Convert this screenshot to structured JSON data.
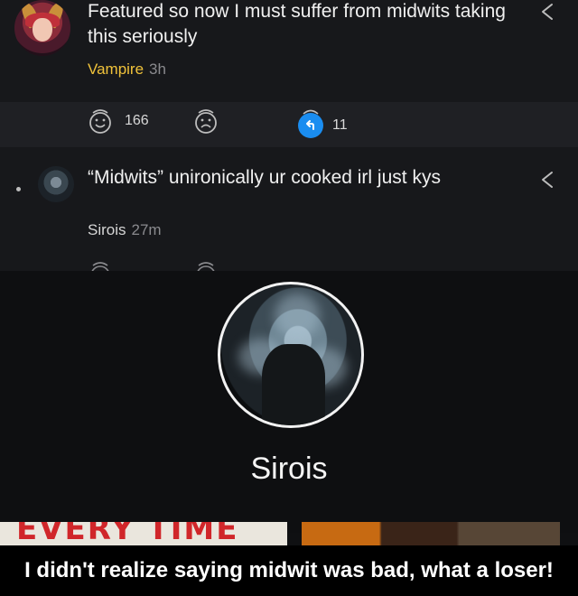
{
  "comments": [
    {
      "text": "Featured so now I must suffer from midwits taking this seriously",
      "author": "Vampire",
      "time": "3h",
      "author_color": "#f0c23a",
      "actions": {
        "upvote_icon": "smiley-face-icon",
        "upvote_count": "166",
        "downvote_icon": "frown-face-icon",
        "reply_icon": "reply-arrow-icon",
        "reply_count": "11"
      }
    },
    {
      "text": "“Midwits” unironically ur cooked irl just kys",
      "author": "Sirois",
      "time": "27m"
    }
  ],
  "profile": {
    "name": "Sirois"
  },
  "thumbnail": {
    "text": "EVERY TIME"
  },
  "caption": {
    "text": "I didn't realize saying midwit was bad, what a loser!"
  },
  "colors": {
    "accent_reply": "#1a8df0",
    "background": "#17181b"
  }
}
